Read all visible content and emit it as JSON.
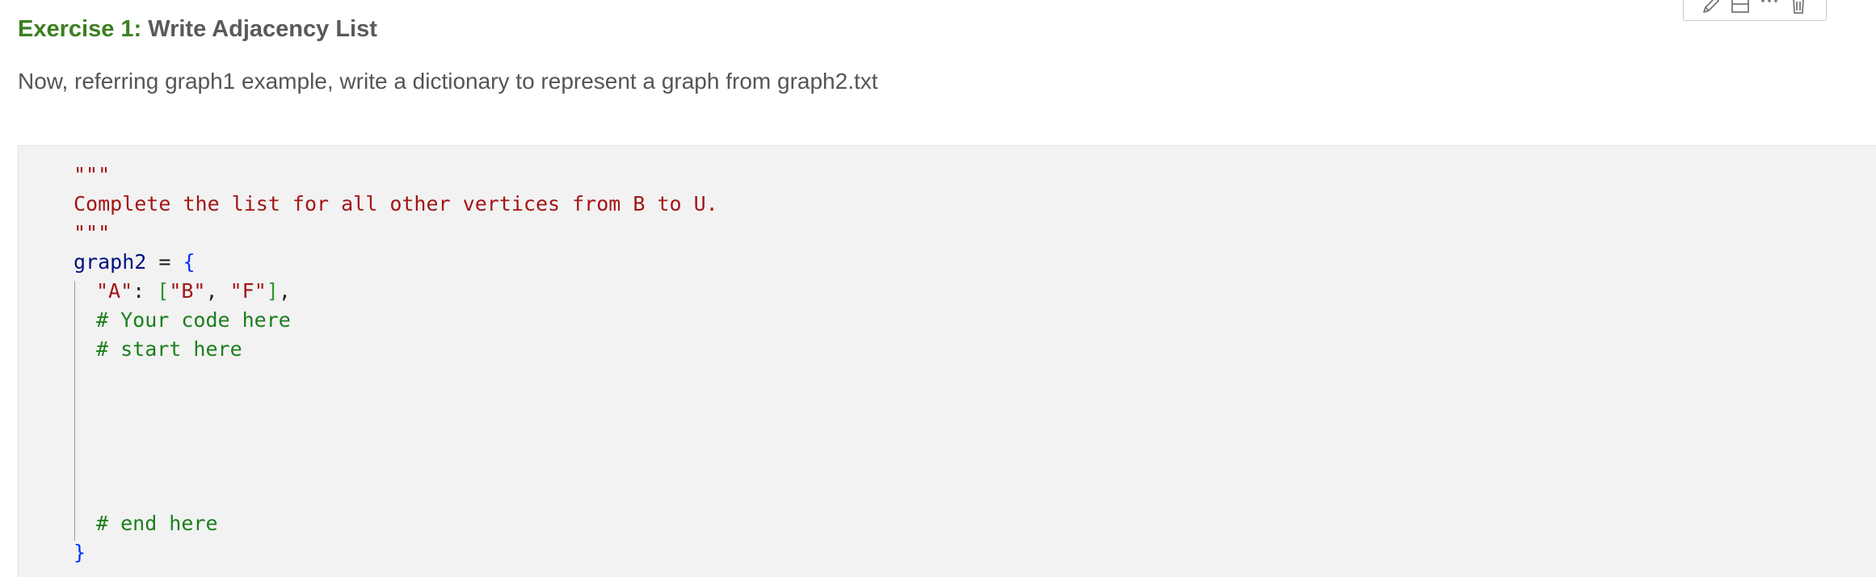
{
  "toolbar": {
    "buttons": [
      {
        "name": "edit",
        "icon": "pencil-icon"
      },
      {
        "name": "split-cell",
        "icon": "split-cell-icon"
      },
      {
        "name": "more",
        "icon": "ellipsis-icon"
      },
      {
        "name": "delete",
        "icon": "trash-icon"
      }
    ]
  },
  "markdown": {
    "exercise_label": "Exercise 1:",
    "title": " Write Adjacency List",
    "description": "Now, referring graph1 example, write a dictionary to represent a graph from graph2.txt"
  },
  "code": {
    "docstring_open": "\"\"\"",
    "docstring_text": "Complete the list for all other vertices from B to U.",
    "docstring_close": "\"\"\"",
    "assign_var": "graph2",
    "assign_op": " = ",
    "open_brace": "{",
    "entry_key": "\"A\"",
    "entry_colon": ": ",
    "list_open": "[",
    "item_b": "\"B\"",
    "comma1": ", ",
    "item_f": "\"F\"",
    "list_close": "]",
    "comma2": ",",
    "comment_your_code": "# Your code here",
    "comment_start": "# start here",
    "comment_end": "# end here",
    "close_brace": "}"
  },
  "colors": {
    "exercise_green": "#3c7f22",
    "string_red": "#a31515",
    "comment_green": "#1b7f1b",
    "variable_navy": "#001080",
    "brace_blue": "#0431fa",
    "cell_background": "#f2f2f2"
  }
}
